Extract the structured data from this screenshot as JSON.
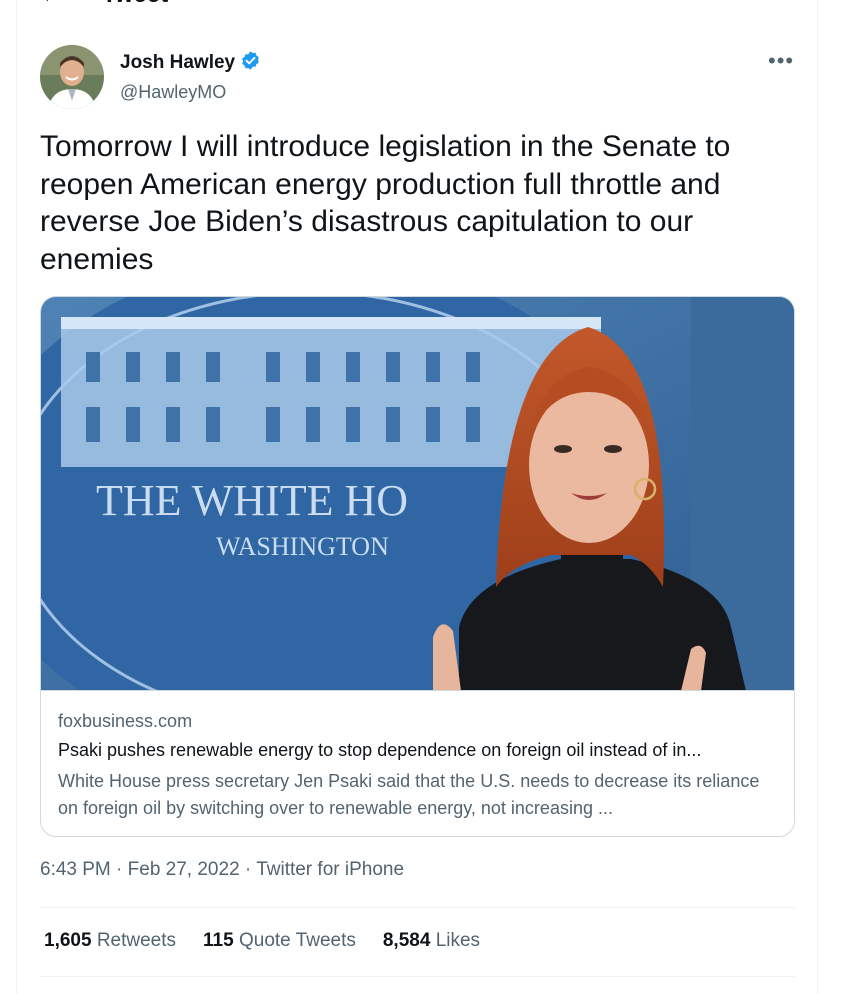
{
  "header": {
    "title": "Tweet"
  },
  "author": {
    "name": "Josh Hawley",
    "handle": "@HawleyMO",
    "verified": true
  },
  "tweet": {
    "text": "Tomorrow I will introduce legislation in the Senate to\nreopen American energy production full throttle and\nreverse Joe Biden’s disastrous capitulation to our\nenemies"
  },
  "card": {
    "image_sign_line1": "THE WHITE HO",
    "image_sign_line2": "WASHINGTON",
    "domain": "foxbusiness.com",
    "title": "Psaki pushes renewable energy to stop dependence on foreign oil instead of in...",
    "description": "White House press secretary Jen Psaki said that the U.S. needs to decrease its reliance on foreign oil by switching over to renewable energy, not increasing ..."
  },
  "meta": {
    "time": "6:43 PM",
    "sep1": " · ",
    "date": "Feb 27, 2022",
    "sep2": " · ",
    "source": "Twitter for iPhone"
  },
  "stats": {
    "retweets_count": "1,605",
    "retweets_label": "Retweets",
    "quotes_count": "115",
    "quotes_label": "Quote Tweets",
    "likes_count": "8,584",
    "likes_label": "Likes"
  },
  "colors": {
    "verified": "#1d9bf0",
    "secondary_text": "#536471",
    "primary_text": "#0f1419",
    "border": "#cfd9de"
  }
}
